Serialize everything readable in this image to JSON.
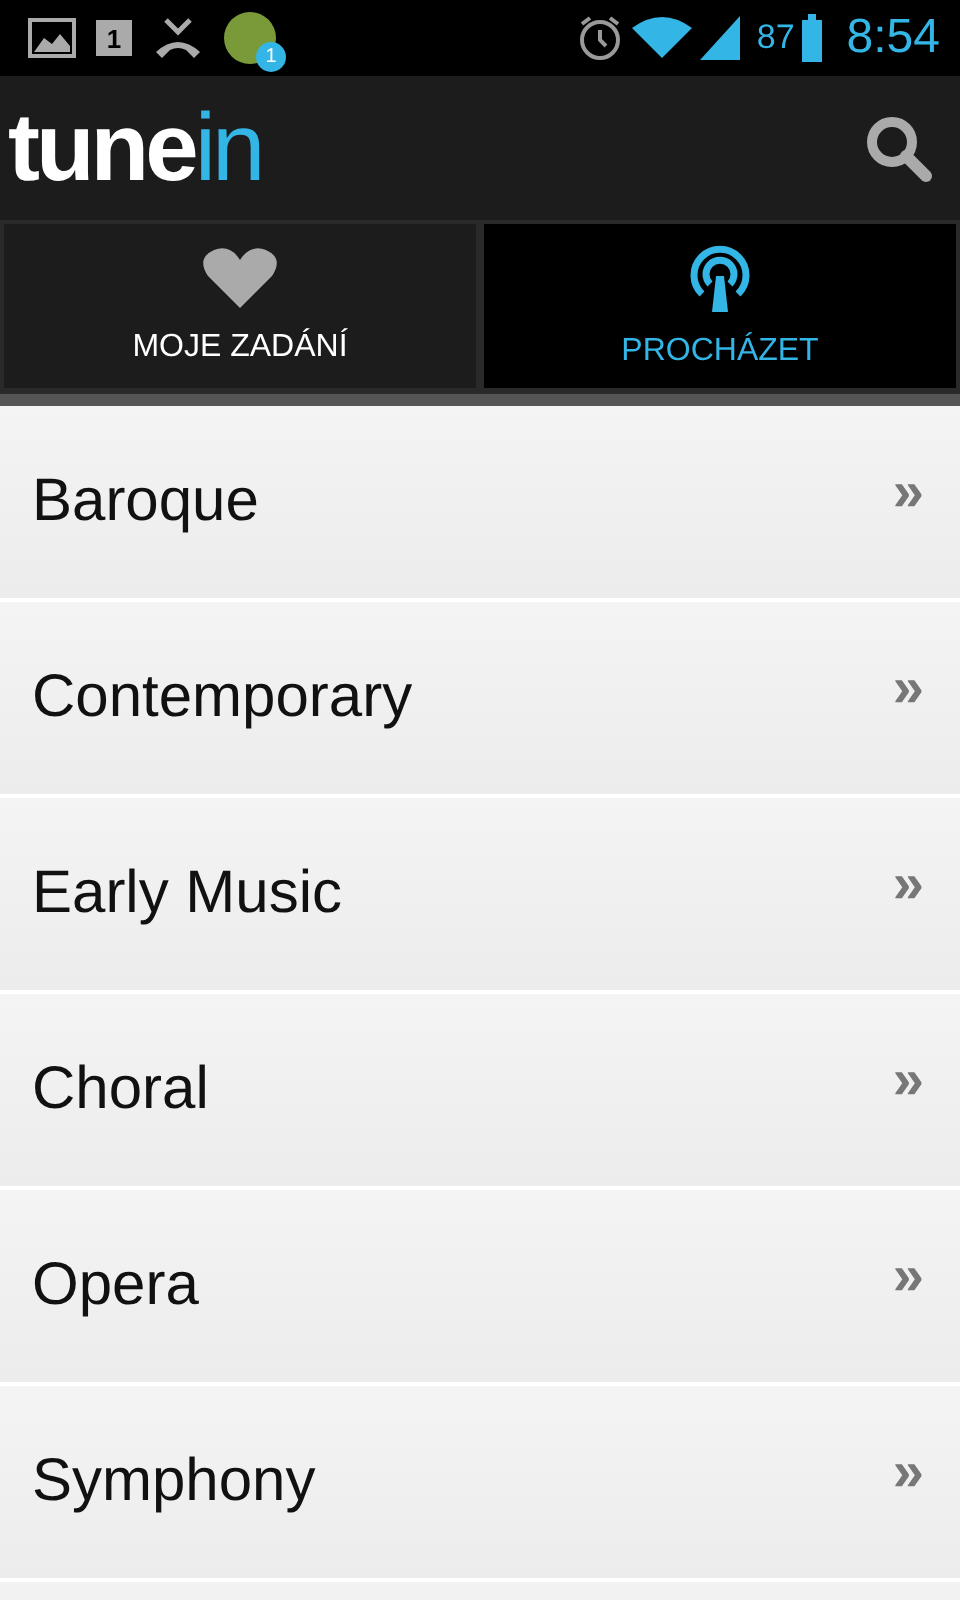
{
  "status_bar": {
    "calendar_day": "1",
    "message_badge": "1",
    "battery": "87",
    "time": "8:54"
  },
  "app_bar": {
    "logo": {
      "main": "tune",
      "accent": "in"
    }
  },
  "tabs": [
    {
      "label": "MOJE ZADÁNÍ",
      "kind": "favorites",
      "selected": false
    },
    {
      "label": "PROCHÁZET",
      "kind": "browse",
      "selected": true
    }
  ],
  "list": [
    {
      "label": "Baroque",
      "chevron": "»"
    },
    {
      "label": "Contemporary",
      "chevron": "»"
    },
    {
      "label": "Early Music",
      "chevron": "»"
    },
    {
      "label": "Choral",
      "chevron": "»"
    },
    {
      "label": "Opera",
      "chevron": "»"
    },
    {
      "label": "Symphony",
      "chevron": "»"
    }
  ]
}
